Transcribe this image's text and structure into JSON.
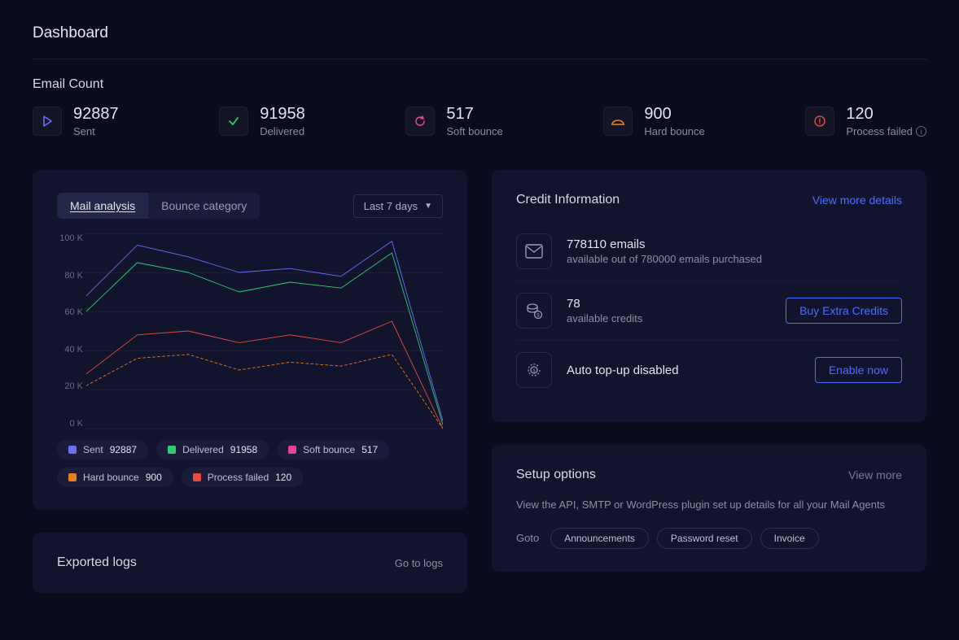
{
  "page_title": "Dashboard",
  "email_count": {
    "section_label": "Email Count",
    "stats": {
      "sent": {
        "value": "92887",
        "label": "Sent",
        "color": "#6a6eff"
      },
      "delivered": {
        "value": "91958",
        "label": "Delivered",
        "color": "#2ecc71"
      },
      "soft": {
        "value": "517",
        "label": "Soft bounce",
        "color": "#e84393"
      },
      "hard": {
        "value": "900",
        "label": "Hard bounce",
        "color": "#e67e22"
      },
      "failed": {
        "value": "120",
        "label": "Process failed",
        "color": "#e74c3c"
      }
    }
  },
  "chart": {
    "tabs": {
      "analysis": "Mail analysis",
      "bounce": "Bounce category"
    },
    "dropdown_label": "Last 7 days",
    "legend": [
      {
        "label": "Sent",
        "value": "92887",
        "color": "#6a6eff"
      },
      {
        "label": "Delivered",
        "value": "91958",
        "color": "#2ecc71"
      },
      {
        "label": "Soft bounce",
        "value": "517",
        "color": "#e84393"
      },
      {
        "label": "Hard bounce",
        "value": "900",
        "color": "#e67e22"
      },
      {
        "label": "Process failed",
        "value": "120",
        "color": "#e74c3c"
      }
    ]
  },
  "chart_data": {
    "type": "line",
    "ylabel": "K",
    "y_ticks": [
      "100 K",
      "80 K",
      "60 K",
      "40 K",
      "20 K",
      "0 K"
    ],
    "ylim": [
      0,
      100
    ],
    "x_count": 8,
    "series": [
      {
        "name": "Sent",
        "color": "#6a6eff",
        "dashed": false,
        "values": [
          68,
          94,
          88,
          80,
          82,
          78,
          96,
          4
        ]
      },
      {
        "name": "Delivered",
        "color": "#2ecc71",
        "dashed": false,
        "values": [
          60,
          85,
          80,
          70,
          75,
          72,
          90,
          2
        ]
      },
      {
        "name": "Process failed",
        "color": "#e74c3c",
        "dashed": false,
        "values": [
          28,
          48,
          50,
          44,
          48,
          44,
          55,
          0
        ]
      },
      {
        "name": "Hard bounce",
        "color": "#e67e22",
        "dashed": true,
        "values": [
          22,
          36,
          38,
          30,
          34,
          32,
          38,
          0
        ]
      }
    ]
  },
  "credit": {
    "title": "Credit Information",
    "view_more": "View more details",
    "emails_main": "778110 emails",
    "emails_sub": "available out of 780000 emails purchased",
    "credits_main": "78",
    "credits_sub": "available credits",
    "buy_credits": "Buy Extra Credits",
    "topup_main": "Auto top-up disabled",
    "enable_now": "Enable now"
  },
  "setup": {
    "title": "Setup options",
    "view_more": "View more",
    "desc": "View the API, SMTP or WordPress plugin set up details for all your Mail Agents",
    "goto_label": "Goto",
    "chips": [
      "Announcements",
      "Password reset",
      "Invoice"
    ]
  },
  "exported": {
    "title": "Exported logs",
    "go_to_logs": "Go to logs"
  }
}
